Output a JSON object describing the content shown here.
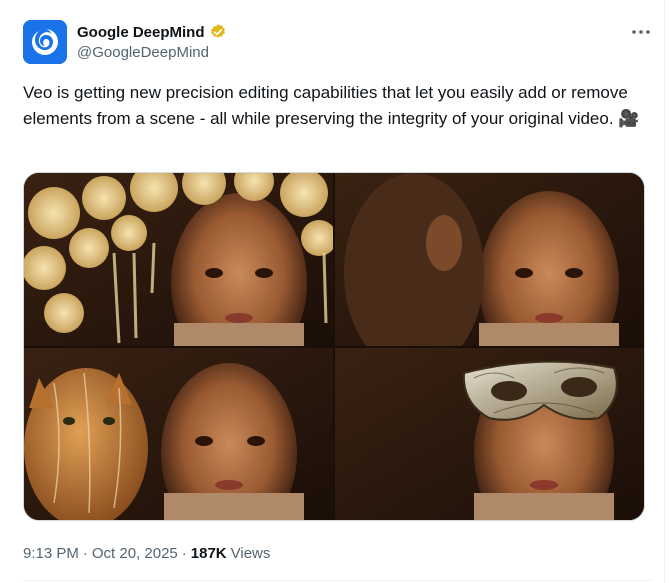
{
  "author": {
    "display_name": "Google DeepMind",
    "handle": "@GoogleDeepMind",
    "verified_badge": "gold-verified-badge-icon"
  },
  "tweet": {
    "text": "Veo is getting new precision editing capabilities that let you easily add or remove elements from a scene - all while preserving the integrity of your original video. 🎥"
  },
  "media": {
    "panels": [
      {
        "name": "media-panel-flowers"
      },
      {
        "name": "media-panel-person"
      },
      {
        "name": "media-panel-cat"
      },
      {
        "name": "media-panel-mask"
      }
    ]
  },
  "meta": {
    "time": "9:13 PM",
    "separator": "·",
    "date": "Oct 20, 2025",
    "views_count": "187K",
    "views_label": "Views"
  },
  "colors": {
    "text_primary": "#0f1419",
    "text_secondary": "#536471",
    "avatar_bg": "#1a73e8",
    "badge_gold": "#e2b719"
  }
}
